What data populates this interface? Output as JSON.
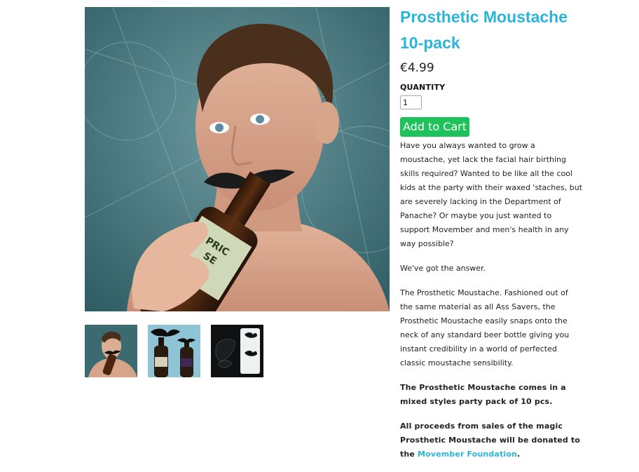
{
  "product": {
    "title": "Prosthetic Moustache 10-pack",
    "price": "€4.99",
    "quantity_label": "QUANTITY",
    "quantity_value": "1",
    "add_to_cart_label": "Add to Cart"
  },
  "images": {
    "main_alt": "Man drinking from a beer bottle with a prosthetic moustache",
    "thumbnails": [
      {
        "alt": "Man with moustache bottle"
      },
      {
        "alt": "Two beer bottles with moustaches"
      },
      {
        "alt": "Moustache shapes on sheet"
      }
    ]
  },
  "description": {
    "p1": "Have you always wanted to grow a moustache, yet lack the facial hair birthing skills required? Wanted to be like all the cool kids at the party with their waxed 'staches, but are severely lacking in the Department of Panache? Or maybe you just wanted to support Movember and men's health in any way possible?",
    "p2": "We've got the answer.",
    "p3": "The Prosthetic Moustache. Fashioned out of the same material as all Ass Savers, the Prosthetic Moustache easily snaps onto the neck of any standard beer bottle giving you instant credibility in a world of perfected classic moustache sensibility.",
    "p4": "The Prosthetic Moustache comes in a mixed styles party pack of 10 pcs.",
    "p5_before": "All proceeds from sales of the magic Prosthetic Moustache will be donated to the ",
    "p5_link": "Movember Foundation",
    "p5_after": "."
  },
  "colors": {
    "title": "#29b6d8",
    "button": "#1ec25a",
    "link": "#29b6d8"
  }
}
